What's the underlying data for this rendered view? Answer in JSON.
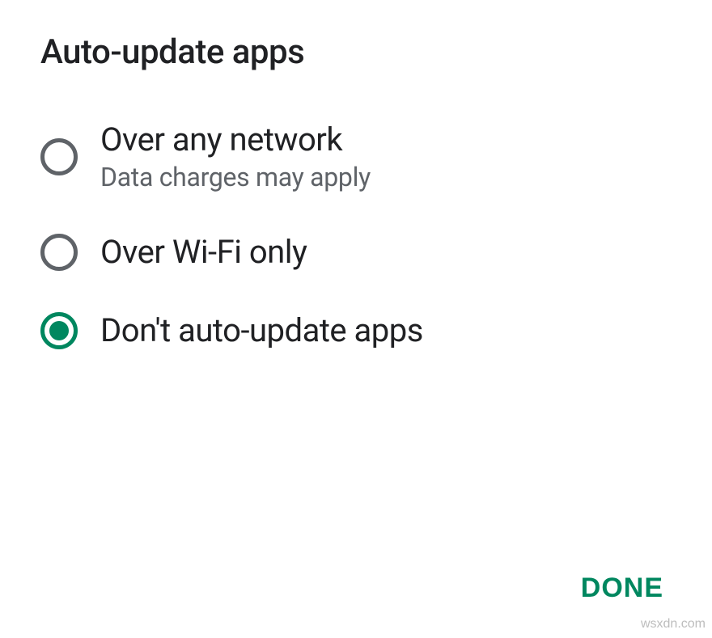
{
  "dialog": {
    "title": "Auto-update apps",
    "options": [
      {
        "label": "Over any network",
        "subtitle": "Data charges may apply",
        "selected": false
      },
      {
        "label": "Over Wi-Fi only",
        "subtitle": "",
        "selected": false
      },
      {
        "label": "Don't auto-update apps",
        "subtitle": "",
        "selected": true
      }
    ],
    "done_label": "DONE"
  },
  "watermark": "wsxdn.com"
}
